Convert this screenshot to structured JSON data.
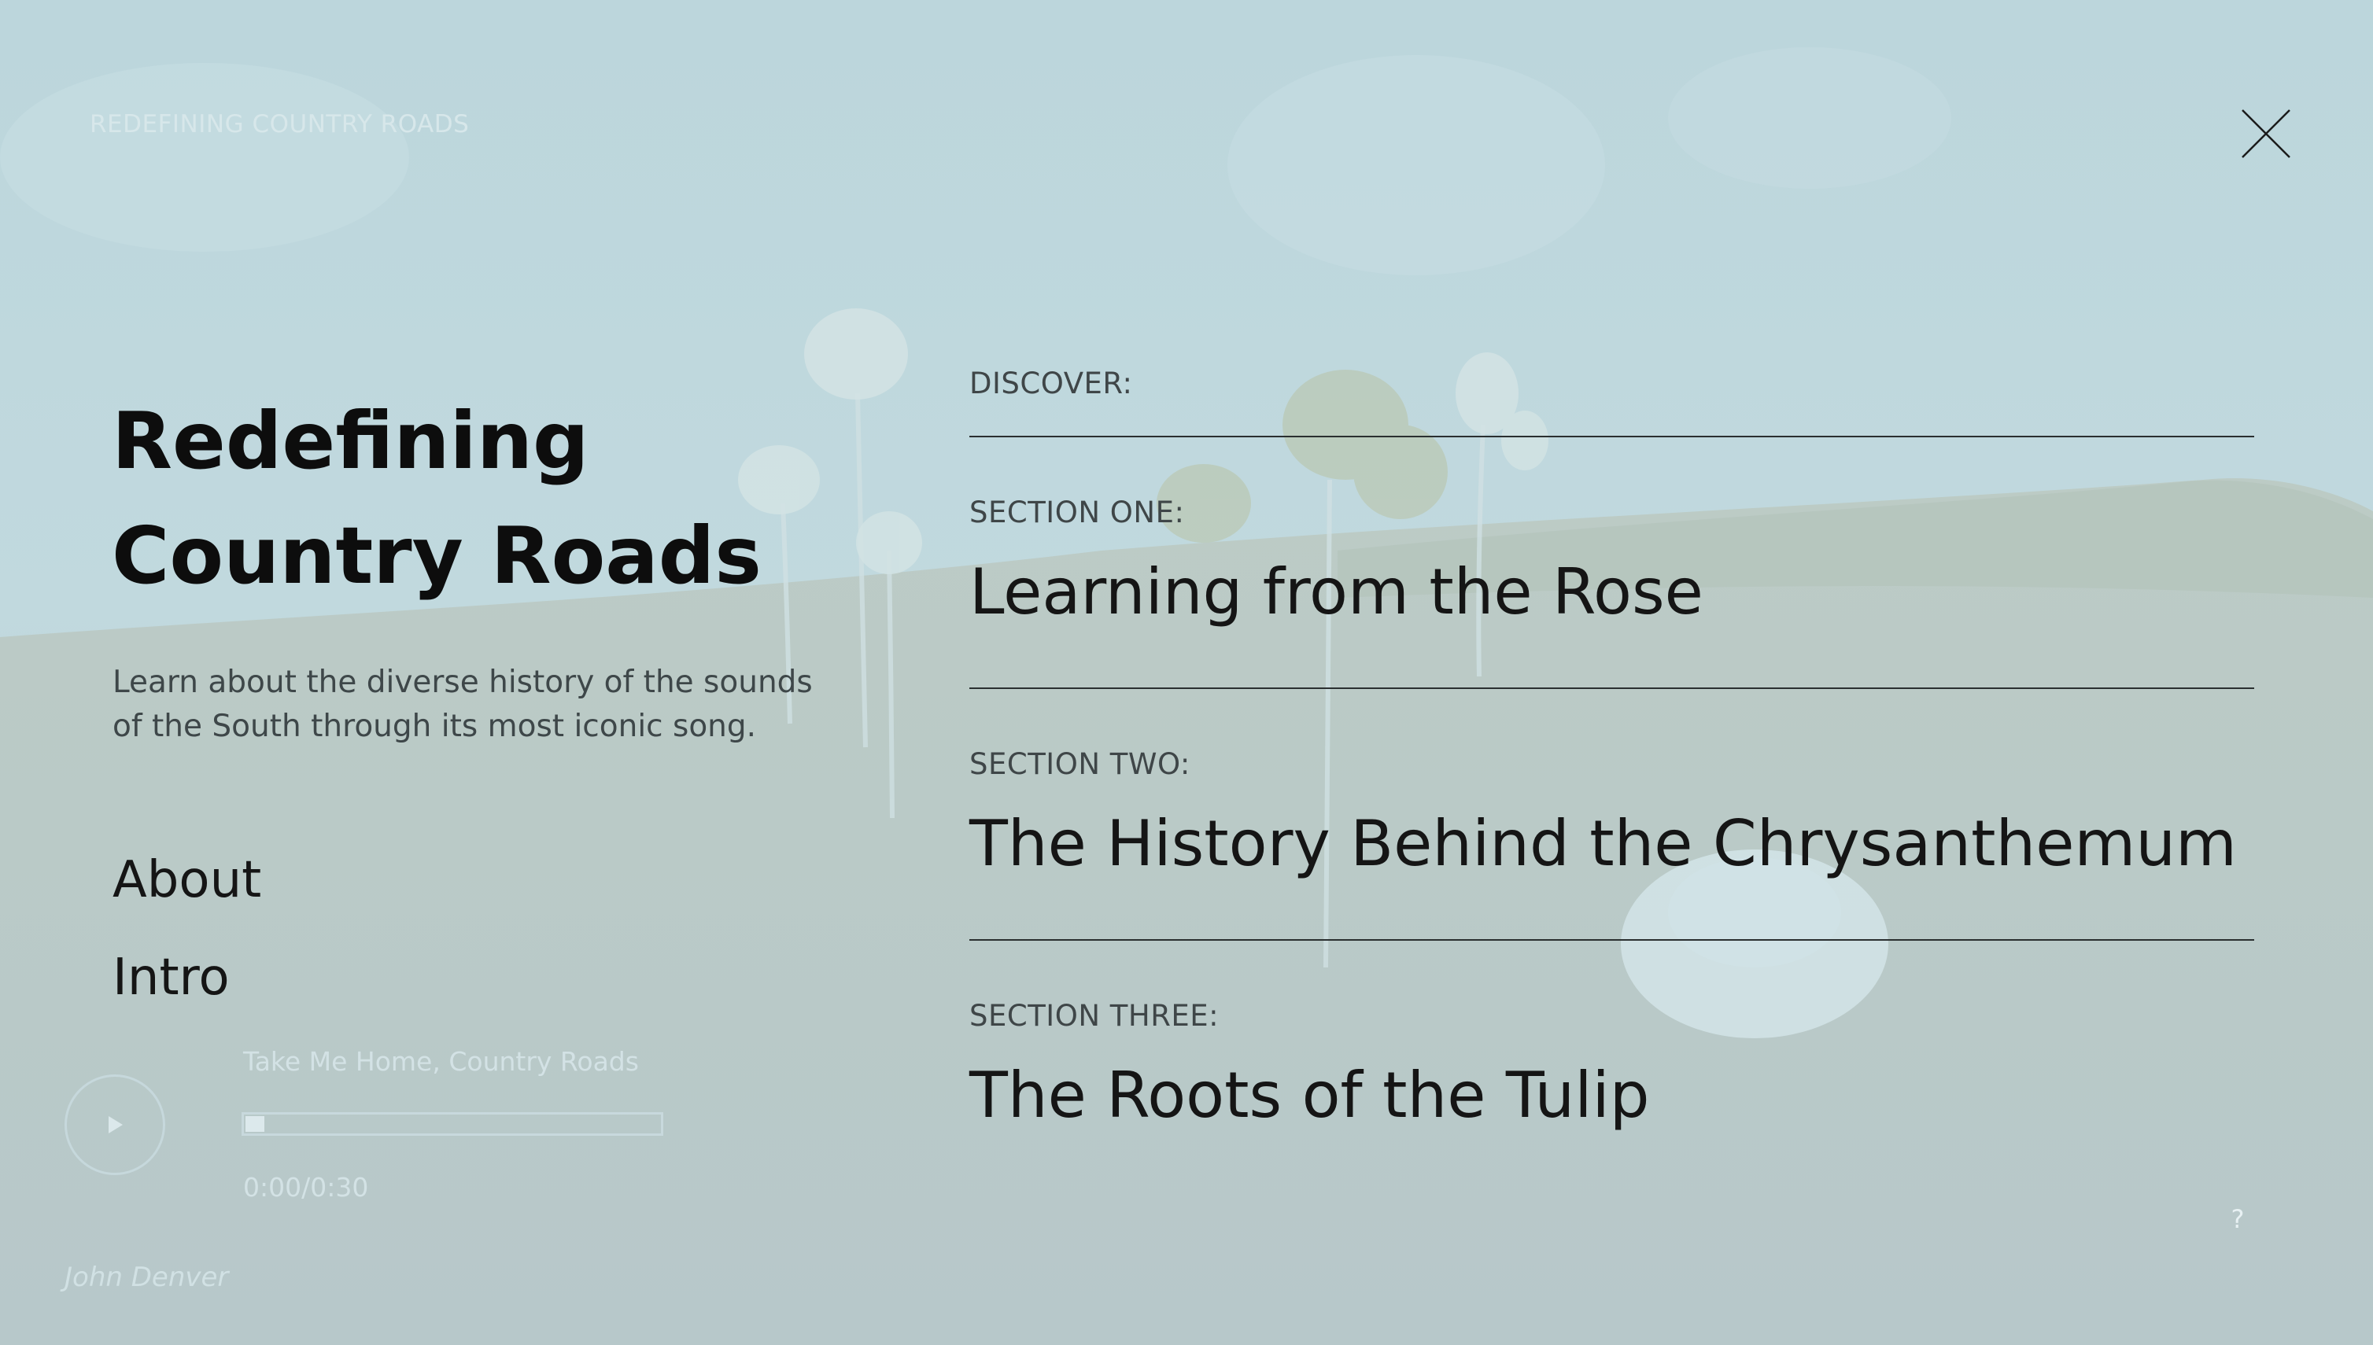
{
  "header": {
    "site_title": "REDEFINING COUNTRY ROADS"
  },
  "icons": {
    "close": "close-icon",
    "play": "play-icon",
    "help": "question-mark-icon"
  },
  "intro": {
    "headline_line1": "Redefining",
    "headline_line2": "Country Roads",
    "description": "Learn about the diverse history of the sounds of the South through its most iconic song."
  },
  "nav": {
    "about": "About",
    "intro": "Intro"
  },
  "player": {
    "track_title": "Take Me Home, Country Roads",
    "time": "0:00/0:30",
    "progress_fraction": 0.0,
    "artist": "John Denver"
  },
  "discover": {
    "label": "DISCOVER:",
    "sections": [
      {
        "label": "SECTION ONE:",
        "title": "Learning from the Rose"
      },
      {
        "label": "SECTION TWO:",
        "title": "The History Behind the Chrysanthemum"
      },
      {
        "label": "SECTION THREE:",
        "title": "The Roots of the Tulip"
      }
    ]
  },
  "help": {
    "label": "?"
  },
  "colors": {
    "overlay": "#bcd3d7",
    "text_dark": "#151515",
    "text_muted": "#3f4648",
    "text_faint": "#d3e2e5",
    "divider": "#2a2f30"
  }
}
